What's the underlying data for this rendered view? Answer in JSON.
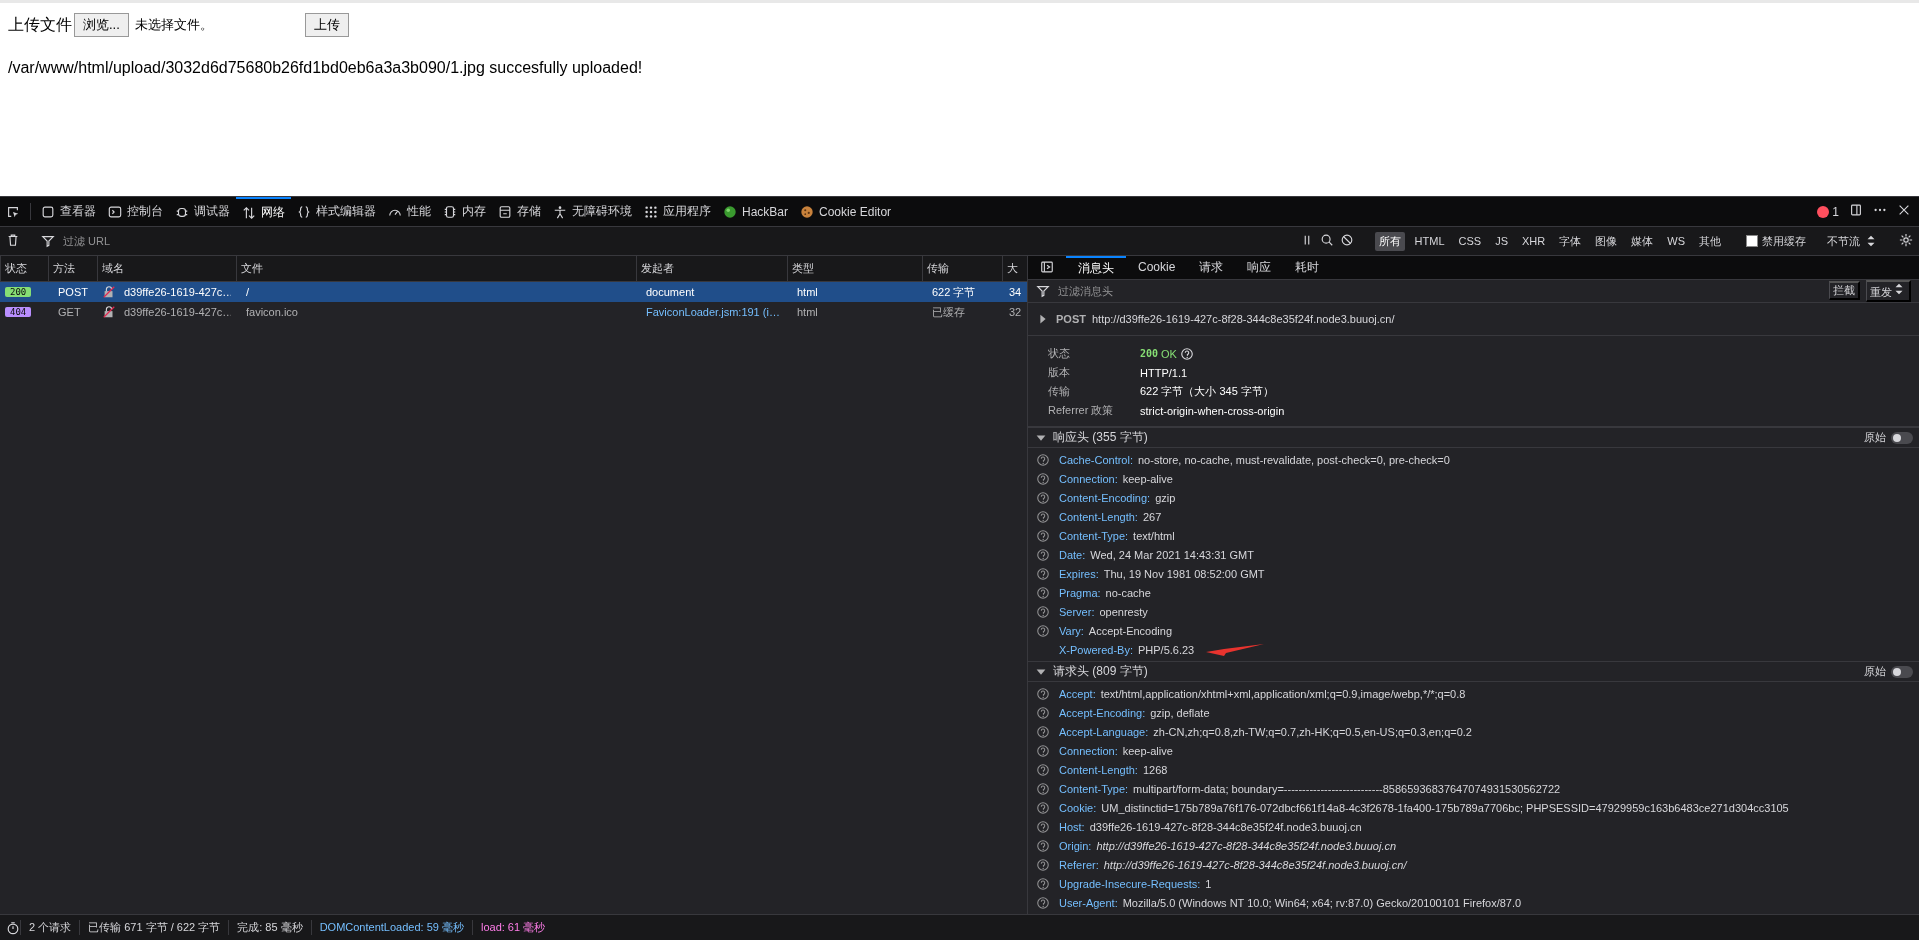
{
  "page": {
    "upload_label": "上传文件",
    "browse_button": "浏览...",
    "file_status": "未选择文件。",
    "upload_button": "上传",
    "message": "/var/www/html/upload/3032d6d75680b26fd1bd0eb6a3a3b090/1.jpg succesfully uploaded!"
  },
  "toolbar": {
    "tabs": [
      {
        "label": "查看器",
        "selected": false
      },
      {
        "label": "控制台",
        "selected": false
      },
      {
        "label": "调试器",
        "selected": false
      },
      {
        "label": "网络",
        "selected": true
      },
      {
        "label": "样式编辑器",
        "selected": false
      },
      {
        "label": "性能",
        "selected": false
      },
      {
        "label": "内存",
        "selected": false
      },
      {
        "label": "存储",
        "selected": false
      },
      {
        "label": "无障碍环境",
        "selected": false
      },
      {
        "label": "应用程序",
        "selected": false
      },
      {
        "label": "HackBar",
        "selected": false
      },
      {
        "label": "Cookie Editor",
        "selected": false
      }
    ],
    "error_count": "1"
  },
  "filter_bar": {
    "placeholder": "过滤 URL",
    "type_filters": [
      {
        "label": "所有",
        "selected": true
      },
      {
        "label": "HTML",
        "selected": false
      },
      {
        "label": "CSS",
        "selected": false
      },
      {
        "label": "JS",
        "selected": false
      },
      {
        "label": "XHR",
        "selected": false
      },
      {
        "label": "字体",
        "selected": false
      },
      {
        "label": "图像",
        "selected": false
      },
      {
        "label": "媒体",
        "selected": false
      },
      {
        "label": "WS",
        "selected": false
      },
      {
        "label": "其他",
        "selected": false
      }
    ],
    "disable_cache": {
      "label": "禁用缓存",
      "checked": false
    },
    "throttle": "不节流"
  },
  "request_table": {
    "columns": [
      "状态",
      "方法",
      "域名",
      "文件",
      "发起者",
      "类型",
      "传输",
      "大"
    ],
    "rows": [
      {
        "status": "200",
        "color": "#86de74",
        "method": "POST",
        "domain": "d39ffe26-1619-427c…",
        "file": "/",
        "initiator": "document",
        "initiator_link": false,
        "type": "html",
        "transferred": "622 字节",
        "size": "34",
        "selected": true
      },
      {
        "status": "404",
        "color": "#b98eff",
        "method": "GET",
        "domain": "d39ffe26-1619-427c…",
        "file": "favicon.ico",
        "initiator": "FaviconLoader.jsm:191 (i…",
        "initiator_link": true,
        "type": "html",
        "transferred": "已缓存",
        "size": "32",
        "selected": false
      }
    ]
  },
  "details": {
    "tabs": [
      {
        "label": "消息头",
        "selected": true
      },
      {
        "label": "Cookie",
        "selected": false
      },
      {
        "label": "请求",
        "selected": false
      },
      {
        "label": "响应",
        "selected": false
      },
      {
        "label": "耗时",
        "selected": false
      }
    ],
    "filter_placeholder": "过滤消息头",
    "block_button": "拦截",
    "resend_button": "重发",
    "request_line": {
      "method": "POST",
      "url": "http://d39ffe26-1619-427c-8f28-344c8e35f24f.node3.buuoj.cn/"
    },
    "summary": [
      {
        "label": "状态",
        "kind": "status",
        "code": "200",
        "value": "OK"
      },
      {
        "label": "版本",
        "kind": "text",
        "value": "HTTP/1.1"
      },
      {
        "label": "传输",
        "kind": "text",
        "value": "622 字节（大小 345 字节）"
      },
      {
        "label": "Referrer 政策",
        "kind": "text",
        "value": "strict-origin-when-cross-origin"
      }
    ],
    "sections": [
      {
        "title": "响应头 (355 字节)",
        "expanded": true,
        "raw_label": "原始",
        "raw_on": false,
        "headers": [
          {
            "name": "Cache-Control:",
            "value": "no-store, no-cache, must-revalidate, post-check=0, pre-check=0",
            "help": true,
            "italic": false
          },
          {
            "name": "Connection:",
            "value": "keep-alive",
            "help": true,
            "italic": false
          },
          {
            "name": "Content-Encoding:",
            "value": "gzip",
            "help": true,
            "italic": false
          },
          {
            "name": "Content-Length:",
            "value": "267",
            "help": true,
            "italic": false
          },
          {
            "name": "Content-Type:",
            "value": "text/html",
            "help": true,
            "italic": false
          },
          {
            "name": "Date:",
            "value": "Wed, 24 Mar 2021 14:43:31 GMT",
            "help": true,
            "italic": false
          },
          {
            "name": "Expires:",
            "value": "Thu, 19 Nov 1981 08:52:00 GMT",
            "help": true,
            "italic": false
          },
          {
            "name": "Pragma:",
            "value": "no-cache",
            "help": true,
            "italic": false
          },
          {
            "name": "Server:",
            "value": "openresty",
            "help": true,
            "italic": false
          },
          {
            "name": "Vary:",
            "value": "Accept-Encoding",
            "help": true,
            "italic": false
          },
          {
            "name": "X-Powered-By:",
            "value": "PHP/5.6.23",
            "help": false,
            "italic": false
          }
        ]
      },
      {
        "title": "请求头 (809 字节)",
        "expanded": true,
        "raw_label": "原始",
        "raw_on": false,
        "headers": [
          {
            "name": "Accept:",
            "value": "text/html,application/xhtml+xml,application/xml;q=0.9,image/webp,*/*;q=0.8",
            "help": true,
            "italic": false
          },
          {
            "name": "Accept-Encoding:",
            "value": "gzip, deflate",
            "help": true,
            "italic": false
          },
          {
            "name": "Accept-Language:",
            "value": "zh-CN,zh;q=0.8,zh-TW;q=0.7,zh-HK;q=0.5,en-US;q=0.3,en;q=0.2",
            "help": true,
            "italic": false
          },
          {
            "name": "Connection:",
            "value": "keep-alive",
            "help": true,
            "italic": false
          },
          {
            "name": "Content-Length:",
            "value": "1268",
            "help": true,
            "italic": false
          },
          {
            "name": "Content-Type:",
            "value": "multipart/form-data; boundary=---------------------------85865936837647074931530562722",
            "help": true,
            "italic": false
          },
          {
            "name": "Cookie:",
            "value": "UM_distinctid=175b789a76f176-072dbcf661f14a8-4c3f2678-1fa400-175b789a7706bc; PHPSESSID=47929959c163b6483ce271d304cc3105",
            "help": true,
            "italic": false
          },
          {
            "name": "Host:",
            "value": "d39ffe26-1619-427c-8f28-344c8e35f24f.node3.buuoj.cn",
            "help": true,
            "italic": false
          },
          {
            "name": "Origin:",
            "value": "http://d39ffe26-1619-427c-8f28-344c8e35f24f.node3.buuoj.cn",
            "help": true,
            "italic": true
          },
          {
            "name": "Referer:",
            "value": "http://d39ffe26-1619-427c-8f28-344c8e35f24f.node3.buuoj.cn/",
            "help": true,
            "italic": true
          },
          {
            "name": "Upgrade-Insecure-Requests:",
            "value": "1",
            "help": true,
            "italic": false
          },
          {
            "name": "User-Agent:",
            "value": "Mozilla/5.0 (Windows NT 10.0; Win64; x64; rv:87.0) Gecko/20100101 Firefox/87.0",
            "help": true,
            "italic": false
          }
        ]
      }
    ]
  },
  "status_bar": [
    {
      "text": "2 个请求",
      "kind": "plain"
    },
    {
      "text": "已传输 671 字节 / 622 字节",
      "kind": "plain"
    },
    {
      "text": "完成: 85 毫秒",
      "kind": "plain"
    },
    {
      "text": "DOMContentLoaded: 59 毫秒",
      "kind": "dom"
    },
    {
      "text": "load: 61 毫秒",
      "kind": "load"
    }
  ]
}
